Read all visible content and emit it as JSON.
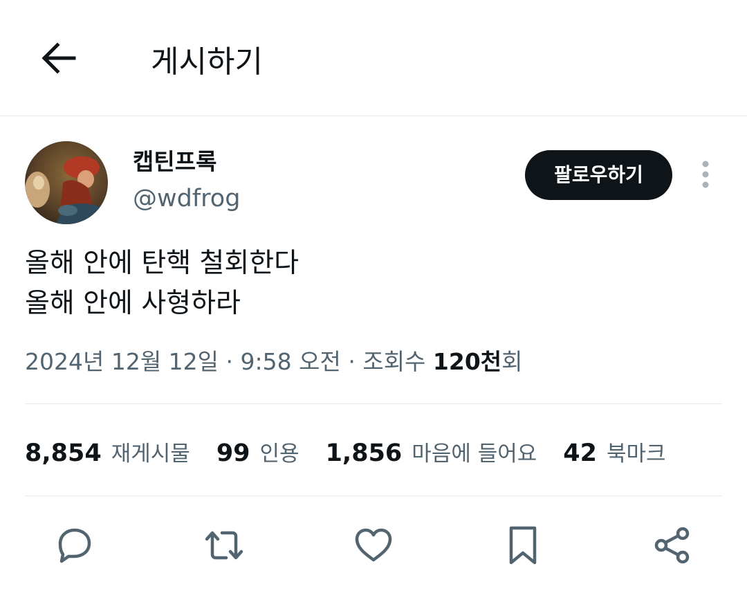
{
  "header": {
    "title": "게시하기",
    "back_icon": "arrow-left-icon"
  },
  "author": {
    "display_name": "캡틴프록",
    "handle": "@wdfrog",
    "follow_label": "팔로우하기",
    "more_icon": "more-vertical-icon"
  },
  "tweet": {
    "lines": [
      "올해 안에 탄핵 철회한다",
      "올해 안에 사형하라"
    ]
  },
  "meta": {
    "date": "2024년 12월 12일",
    "sep1": " · ",
    "time": "9:58 오전",
    "sep2": " · ",
    "views_label": "조회수 ",
    "views_count": "120천",
    "views_suffix": "회"
  },
  "stats": [
    {
      "count": "8,854",
      "label": "재게시물"
    },
    {
      "count": "99",
      "label": "인용"
    },
    {
      "count": "1,856",
      "label": "마음에 들어요"
    },
    {
      "count": "42",
      "label": "북마크"
    }
  ],
  "actions": [
    {
      "icon": "reply-icon"
    },
    {
      "icon": "repost-icon"
    },
    {
      "icon": "like-icon"
    },
    {
      "icon": "bookmark-icon"
    },
    {
      "icon": "share-icon"
    }
  ],
  "colors": {
    "primary_text": "#0f1419",
    "secondary_text": "#536471",
    "divider": "#e6e9eb",
    "follow_bg": "#0f1419"
  }
}
